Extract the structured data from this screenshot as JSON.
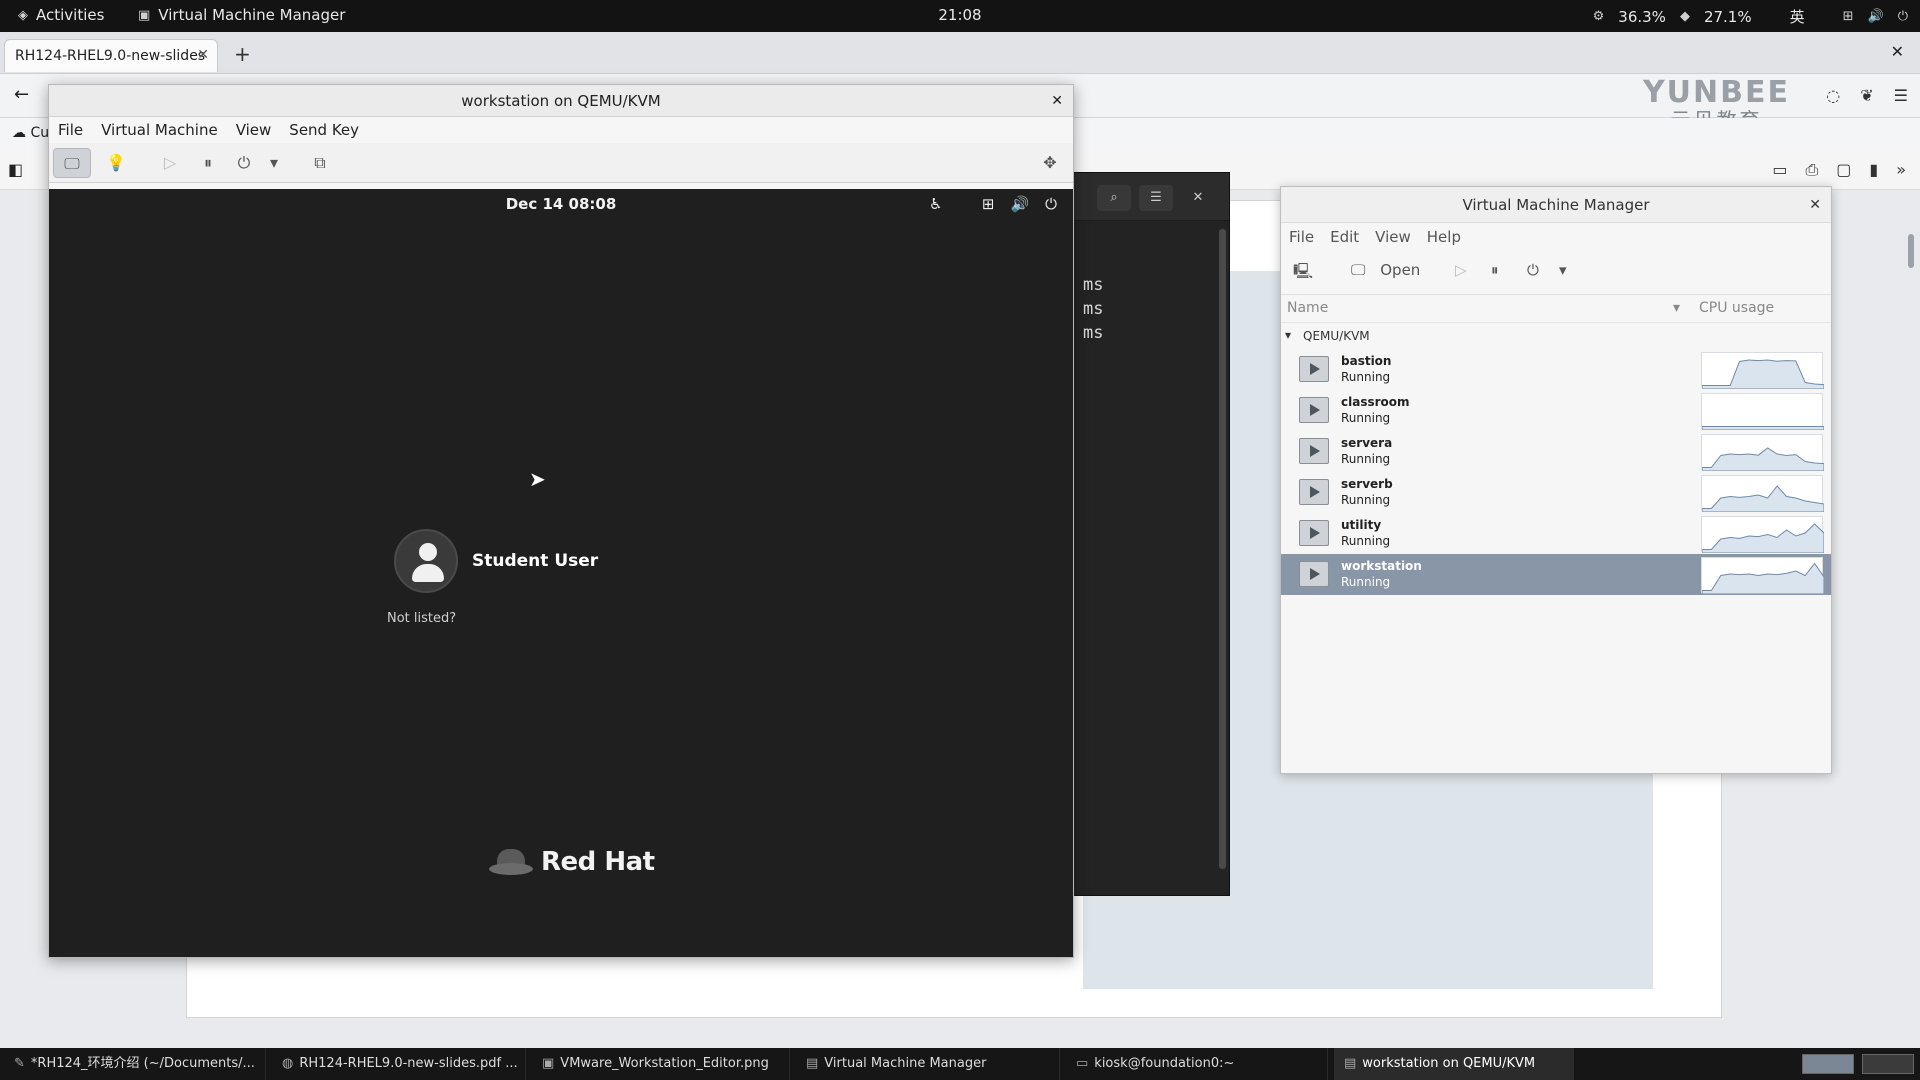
{
  "topbar": {
    "activities": "Activities",
    "app_name": "Virtual Machine Manager",
    "clock": "21:08",
    "cpu_pct": "36.3%",
    "mem_pct": "27.1%",
    "input_method": "英"
  },
  "browser": {
    "tab_title": "RH124-RHEL9.0-new-slides",
    "bookmark_partial": "Cu",
    "watermark_logo": "YUNBEE",
    "watermark_cn": "云贝教育"
  },
  "terminal": {
    "lines": [
      "ms",
      "ms",
      "ms"
    ]
  },
  "viewer": {
    "title": "workstation on QEMU/KVM",
    "menu": [
      "File",
      "Virtual Machine",
      "View",
      "Send Key"
    ],
    "guest": {
      "date": "Dec 14  08:08",
      "user": "Student User",
      "not_listed": "Not listed?",
      "brand": "Red Hat"
    }
  },
  "vmm": {
    "title": "Virtual Machine Manager",
    "menu": [
      "File",
      "Edit",
      "View",
      "Help"
    ],
    "open_label": "Open",
    "col_name": "Name",
    "col_cpu": "CPU usage",
    "group": "QEMU/KVM",
    "vms": [
      {
        "name": "bastion",
        "status": "Running",
        "cpu": [
          0.05,
          0.05,
          0.05,
          0.05,
          0.85,
          0.9,
          0.88,
          0.9,
          0.86,
          0.88,
          0.87,
          0.15,
          0.1,
          0.08
        ]
      },
      {
        "name": "classroom",
        "status": "Running",
        "cpu": [
          0.05,
          0.05,
          0.05,
          0.05,
          0.05,
          0.05,
          0.05,
          0.05,
          0.05,
          0.05,
          0.05,
          0.05,
          0.05,
          0.05
        ]
      },
      {
        "name": "servera",
        "status": "Running",
        "cpu": [
          0.05,
          0.05,
          0.45,
          0.5,
          0.48,
          0.5,
          0.46,
          0.7,
          0.5,
          0.45,
          0.48,
          0.25,
          0.2,
          0.18
        ]
      },
      {
        "name": "serverb",
        "status": "Running",
        "cpu": [
          0.05,
          0.05,
          0.4,
          0.45,
          0.42,
          0.45,
          0.5,
          0.4,
          0.8,
          0.45,
          0.4,
          0.3,
          0.25,
          0.2
        ]
      },
      {
        "name": "utility",
        "status": "Running",
        "cpu": [
          0.05,
          0.05,
          0.4,
          0.45,
          0.42,
          0.5,
          0.48,
          0.55,
          0.45,
          0.7,
          0.5,
          0.6,
          0.9,
          0.6
        ]
      },
      {
        "name": "workstation",
        "status": "Running",
        "cpu": [
          0.05,
          0.05,
          0.55,
          0.6,
          0.58,
          0.6,
          0.55,
          0.6,
          0.58,
          0.62,
          0.7,
          0.55,
          0.95,
          0.5
        ]
      }
    ],
    "selected_index": 5
  },
  "taskbar": {
    "items": [
      {
        "label": "*RH124_环境介绍 (~/Documents/...",
        "icon": "editor-icon"
      },
      {
        "label": "RH124-RHEL9.0-new-slides.pdf ...",
        "icon": "browser-icon"
      },
      {
        "label": "VMware_Workstation_Editor.png",
        "icon": "image-icon"
      },
      {
        "label": "Virtual Machine Manager",
        "icon": "vmm-icon"
      },
      {
        "label": "kiosk@foundation0:~",
        "icon": "terminal-icon"
      },
      {
        "label": "workstation on QEMU/KVM",
        "icon": "vmm-icon"
      }
    ],
    "active_index": 5
  },
  "colors": {
    "selection": "#8896a8",
    "guest_bg": "#1f1f1f",
    "topbar": "#131313"
  }
}
